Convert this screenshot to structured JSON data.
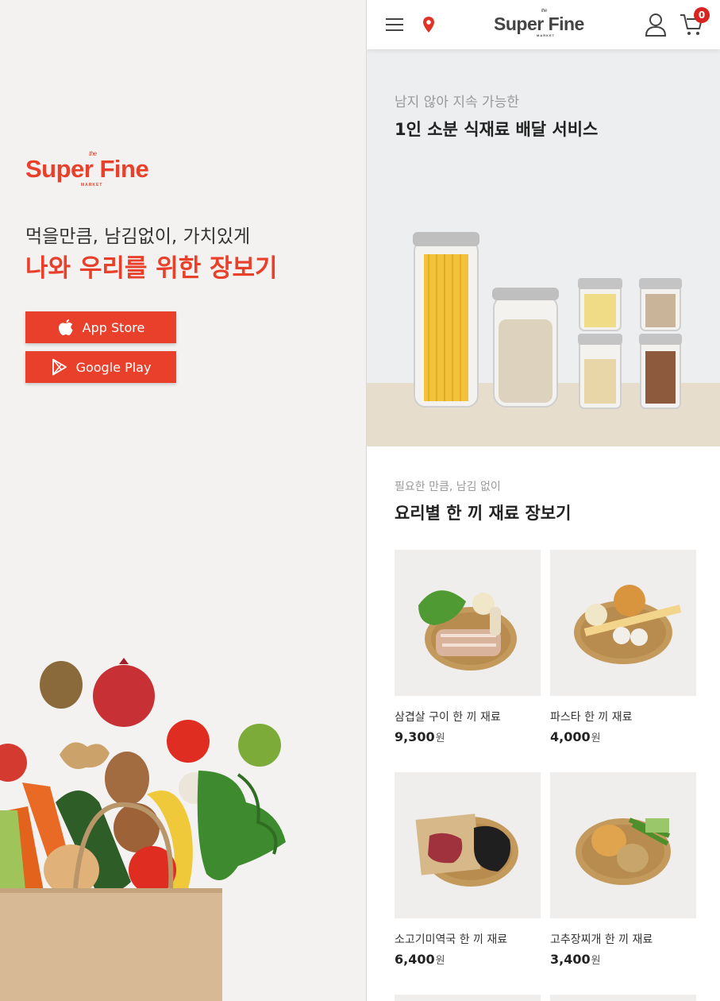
{
  "brand": {
    "the": "the",
    "name": "Super Fine",
    "market": "MARKET"
  },
  "left": {
    "tagline_line1": "먹을만큼, 남김없이, 가치있게",
    "tagline_line2": "나와 우리를 위한 장보기",
    "app_store_label": "App Store",
    "google_play_label": "Google Play"
  },
  "header": {
    "cart_count": "0"
  },
  "hero": {
    "subtitle": "남지 않아 지속 가능한",
    "title": "1인 소분 식재료 배달 서비스"
  },
  "section": {
    "subtitle": "필요한 만큼, 남김 없이",
    "title": "요리별 한 끼 재료 장보기"
  },
  "products": [
    {
      "name": "삼겹살 구이 한 끼 재료",
      "price": "9,300",
      "unit": "원"
    },
    {
      "name": "파스타 한 끼 재료",
      "price": "4,000",
      "unit": "원"
    },
    {
      "name": "소고기미역국 한 끼 재료",
      "price": "6,400",
      "unit": "원"
    },
    {
      "name": "고추장찌개 한 끼 재료",
      "price": "3,400",
      "unit": "원"
    }
  ],
  "colors": {
    "accent": "#e8402b",
    "badge": "#d8231e",
    "text": "#222222",
    "muted": "#999999"
  }
}
